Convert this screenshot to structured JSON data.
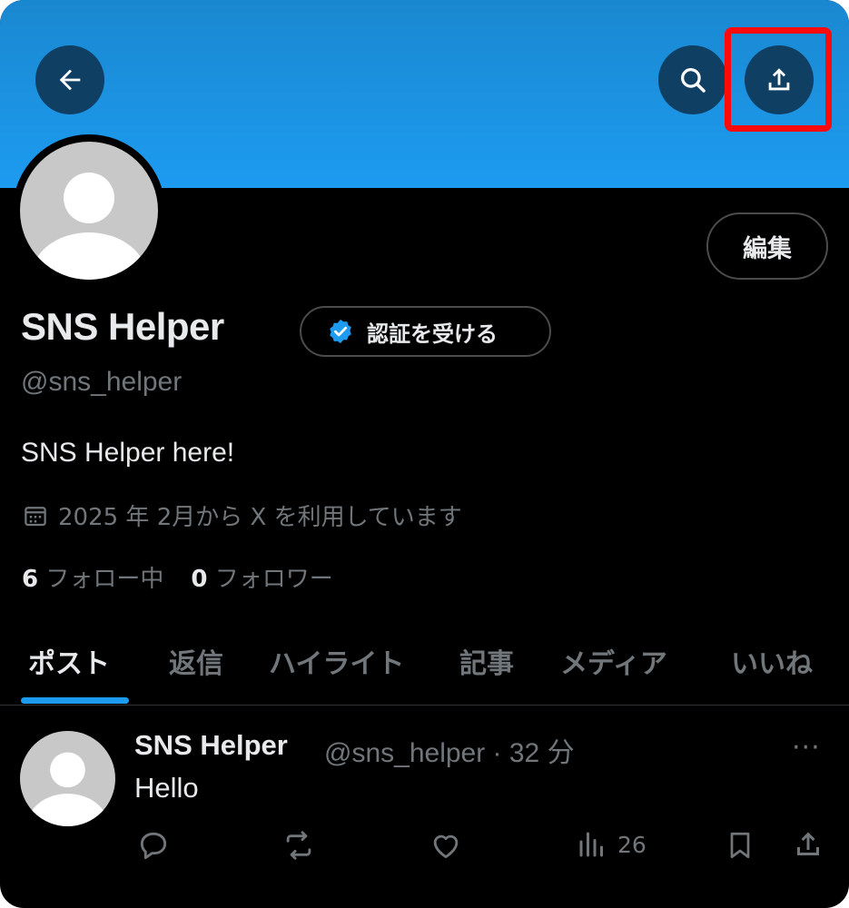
{
  "profile": {
    "name": "SNS Helper",
    "verify_label": "認証を受ける",
    "handle": "@sns_helper",
    "bio": "SNS Helper here!",
    "joined": "2025 年 2月から X を利用しています",
    "following_count": "6",
    "following_label": "フォロー中",
    "followers_count": "0",
    "followers_label": "フォロワー",
    "edit_label": "編集"
  },
  "tabs": [
    {
      "label": "ポスト",
      "active": true
    },
    {
      "label": "返信"
    },
    {
      "label": "ハイライト"
    },
    {
      "label": "記事"
    },
    {
      "label": "メディア"
    },
    {
      "label": "いいね"
    }
  ],
  "post": {
    "name": "SNS Helper",
    "meta": "@sns_helper · 32 分",
    "text": "Hello",
    "views": "26",
    "more": "···"
  },
  "colors": {
    "banner": "#1d9bf0",
    "accent": "#1d9bf0",
    "highlight": "#ff0a0a",
    "background": "#000000"
  },
  "icons": [
    "back-arrow-icon",
    "search-icon",
    "share-icon",
    "verified-badge-icon",
    "calendar-icon",
    "reply-icon",
    "repost-icon",
    "like-icon",
    "views-icon",
    "bookmark-icon",
    "more-icon"
  ]
}
